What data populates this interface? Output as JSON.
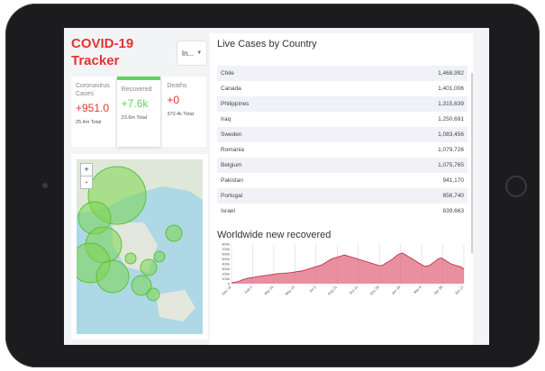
{
  "app": {
    "title": "COVID-19 Tracker"
  },
  "country_select": {
    "value": "In..."
  },
  "cards": [
    {
      "label": "Coronavirus Cases",
      "value": "+951.0",
      "total": "25.4m Total"
    },
    {
      "label": "Recovered",
      "value": "+7.6k",
      "total": "23.6m Total"
    },
    {
      "label": "Deaths",
      "value": "+0",
      "total": "370.4k Total"
    }
  ],
  "map": {
    "zoom_in": "+",
    "zoom_out": "-"
  },
  "live_cases": {
    "title": "Live Cases by Country",
    "rows": [
      {
        "country": "Chile",
        "cases": "1,468,992"
      },
      {
        "country": "Canada",
        "cases": "1,401,006"
      },
      {
        "country": "Philippines",
        "cases": "1,315,639"
      },
      {
        "country": "Iraq",
        "cases": "1,250,691"
      },
      {
        "country": "Sweden",
        "cases": "1,083,456"
      },
      {
        "country": "Romania",
        "cases": "1,079,726"
      },
      {
        "country": "Belgium",
        "cases": "1,075,765"
      },
      {
        "country": "Pakistan",
        "cases": "941,170"
      },
      {
        "country": "Portugal",
        "cases": "856,740"
      },
      {
        "country": "Israel",
        "cases": "839,663"
      }
    ]
  },
  "colors": {
    "accent": "#e3342f",
    "recovered": "#5cd65c",
    "chart_fill": "#e06a80",
    "chart_line": "#c0213f",
    "map_bubble": "#7bd64f"
  },
  "chart_data": {
    "type": "area",
    "title": "Worldwide new recovered",
    "y_ticks": [
      "800k",
      "700k",
      "600k",
      "500k",
      "400k",
      "300k",
      "200k",
      "100k",
      "0"
    ],
    "x_ticks": [
      "Dec 14",
      "Feb 2",
      "Mar 24",
      "May 13",
      "Jul 2",
      "Aug 21",
      "Oct 10",
      "Nov 29",
      "Jan 18",
      "Mar 9",
      "Apr 28",
      "Jun 17"
    ],
    "ylim": [
      0,
      800000
    ],
    "values": [
      20000,
      30000,
      40000,
      70000,
      90000,
      110000,
      120000,
      130000,
      145000,
      150000,
      160000,
      170000,
      180000,
      190000,
      200000,
      205000,
      210000,
      215000,
      220000,
      230000,
      240000,
      250000,
      260000,
      280000,
      300000,
      320000,
      340000,
      360000,
      380000,
      420000,
      460000,
      500000,
      520000,
      540000,
      560000,
      580000,
      560000,
      540000,
      520000,
      500000,
      480000,
      460000,
      440000,
      420000,
      400000,
      380000,
      360000,
      380000,
      420000,
      460000,
      500000,
      560000,
      600000,
      620000,
      580000,
      540000,
      500000,
      460000,
      420000,
      380000,
      350000,
      360000,
      400000,
      450000,
      500000,
      520000,
      480000,
      440000,
      400000,
      380000,
      360000,
      340000,
      300000
    ]
  }
}
